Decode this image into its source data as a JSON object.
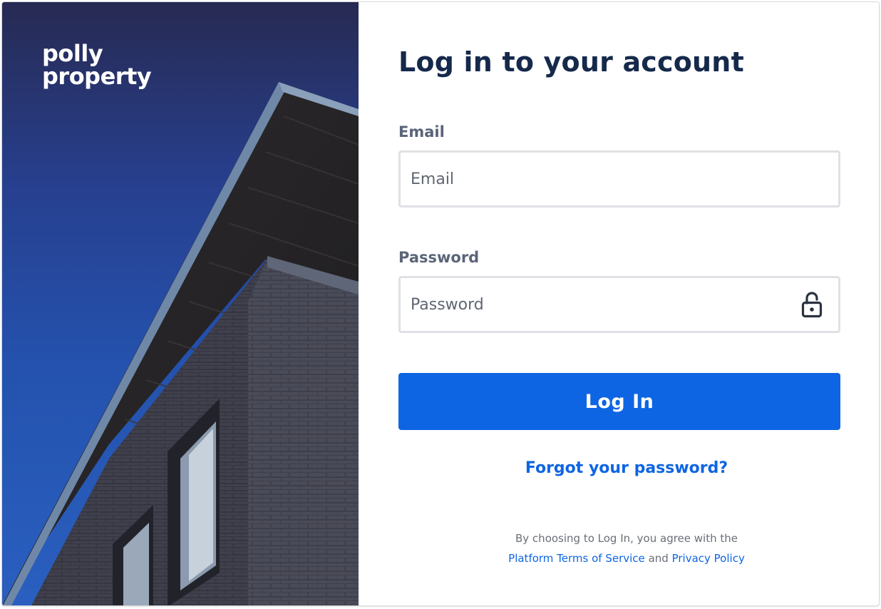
{
  "brand": {
    "logo_line1": "polly",
    "logo_line2": "property",
    "accent_color": "#0e65e3",
    "hero_colors": [
      "#272a52",
      "#2452ae"
    ]
  },
  "login": {
    "title": "Log in to your account",
    "email": {
      "label": "Email",
      "placeholder": "Email",
      "value": ""
    },
    "password": {
      "label": "Password",
      "placeholder": "Password",
      "value": "",
      "icon": "unlock-icon"
    },
    "submit_label": "Log In",
    "forgot_label": "Forgot your password?"
  },
  "terms": {
    "prefix": "By choosing to Log In, you agree with the",
    "terms_link": "Platform Terms of Service",
    "joiner": "and",
    "privacy_link": "Privacy Policy"
  }
}
